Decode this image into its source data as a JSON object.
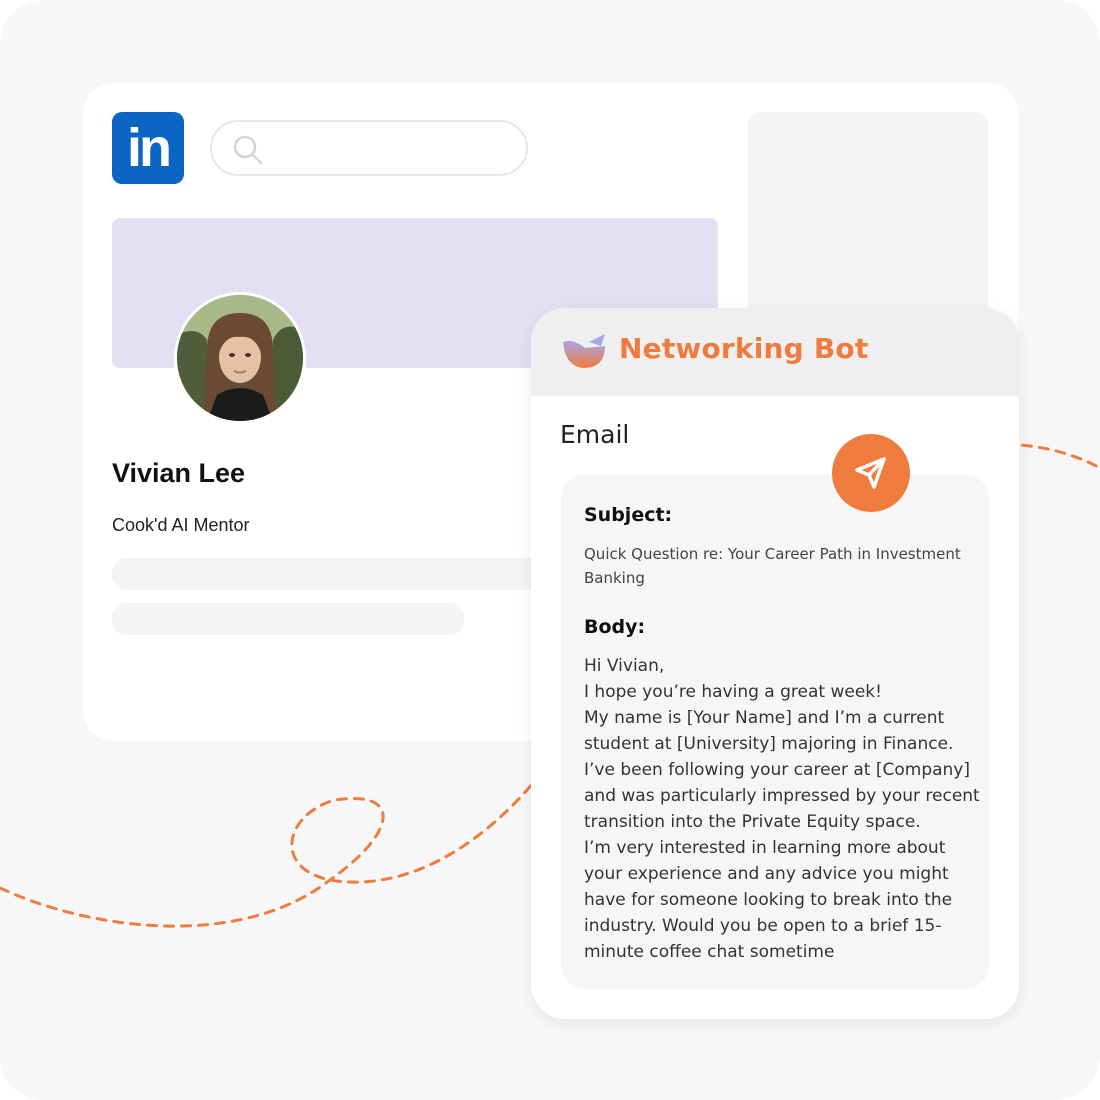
{
  "colors": {
    "linkedin_blue": "#0a66c2",
    "banner": "#e2e0f2",
    "accent_orange": "#f07b3f"
  },
  "header": {
    "logo_text": "in",
    "logo_icon": "linkedin-logo",
    "search_icon": "search-icon",
    "search_placeholder": ""
  },
  "profile": {
    "name": "Vivian Lee",
    "title": "Cook'd AI Mentor",
    "avatar": "profile-photo"
  },
  "bot": {
    "title": "Networking Bot",
    "logo_icon": "bot-logo-icon",
    "section_label": "Email",
    "send_icon": "send-icon",
    "subject_label": "Subject:",
    "subject_text": "Quick Question re: Your Career Path in Investment Banking",
    "body_label": "Body:",
    "body_lines": [
      "Hi Vivian,",
      "I hope you’re having a great week!",
      "My name is [Your Name] and I’m a current student at [University] majoring in Finance. I’ve been following your career at [Company] and was particularly impressed by your recent transition into the Private Equity space.",
      "I’m very interested in learning more about your experience and any advice you might have for someone looking to break into the industry. Would you be open to a brief 15-minute coffee chat sometime"
    ]
  }
}
